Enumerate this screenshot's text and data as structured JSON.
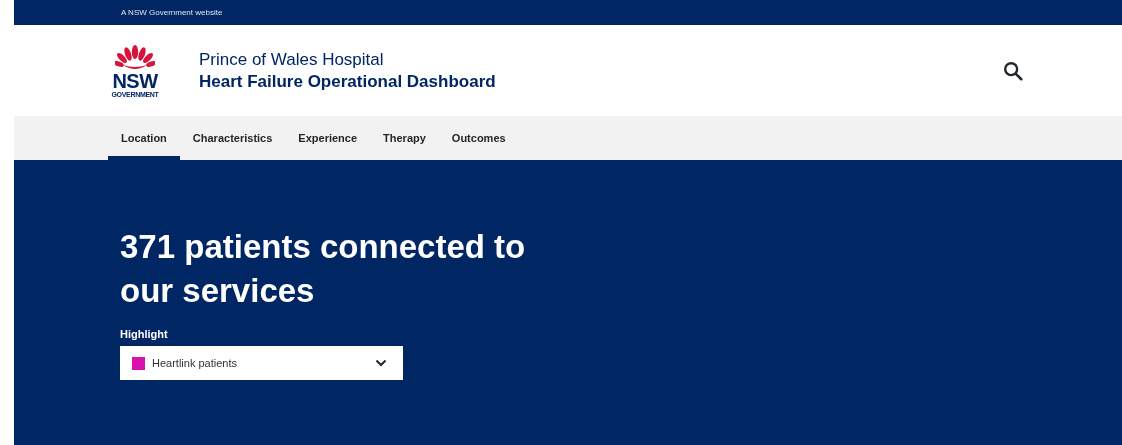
{
  "masthead": {
    "text": "A NSW Government website"
  },
  "header": {
    "logo": {
      "word": "NSW",
      "subword": "GOVERNMENT"
    },
    "site_name": "Prince of Wales Hospital",
    "title": "Heart Failure Operational Dashboard"
  },
  "nav": [
    {
      "label": "Location",
      "selected": true
    },
    {
      "label": "Characteristics",
      "selected": false
    },
    {
      "label": "Experience",
      "selected": false
    },
    {
      "label": "Therapy",
      "selected": false
    },
    {
      "label": "Outcomes",
      "selected": false
    }
  ],
  "hero": {
    "heading": "371 patients connected to our services",
    "highlight": {
      "label": "Highlight",
      "value": "Heartlink patients",
      "color": "#d912ae"
    }
  }
}
